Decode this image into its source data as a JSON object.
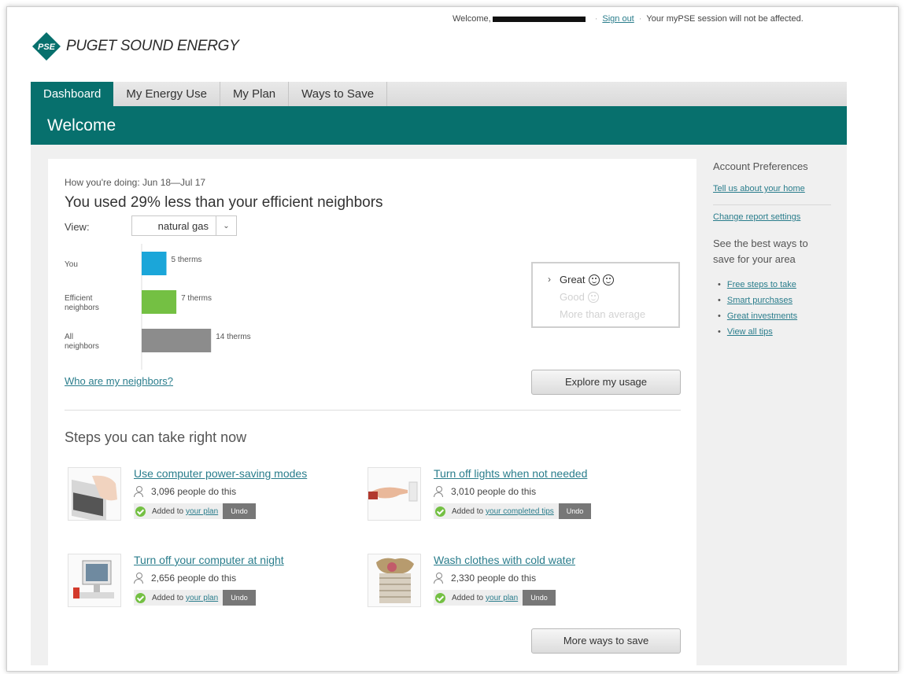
{
  "header": {
    "welcome_prefix": "Welcome,",
    "sign_out": "Sign out",
    "session_note": "Your myPSE session will not be affected."
  },
  "logo": {
    "badge": "PSE",
    "brand": "PUGET SOUND ENERGY",
    "color": "#07706d"
  },
  "tabs": [
    {
      "label": "Dashboard",
      "active": true
    },
    {
      "label": "My Energy Use",
      "active": false
    },
    {
      "label": "My Plan",
      "active": false
    },
    {
      "label": "Ways to Save",
      "active": false
    }
  ],
  "page_title": "Welcome",
  "summary": {
    "period": "How you're doing: Jun 18—Jul 17",
    "headline": "You used 29% less than your efficient neighbors",
    "view_label": "View:",
    "view_value": "natural gas"
  },
  "chart_data": {
    "type": "bar",
    "orientation": "horizontal",
    "categories": [
      "You",
      "Efficient neighbors",
      "All neighbors"
    ],
    "category_lines": [
      [
        "You"
      ],
      [
        "Efficient",
        "neighbors"
      ],
      [
        "All",
        "neighbors"
      ]
    ],
    "values": [
      5,
      7,
      14
    ],
    "value_labels": [
      "5 therms",
      "7 therms",
      "14 therms"
    ],
    "colors": [
      "#1ba6d9",
      "#74c043",
      "#8c8c8c"
    ]
  },
  "rating": {
    "great": "Great",
    "good": "Good",
    "more": "More than average",
    "selected": "Great"
  },
  "links": {
    "neighbors": "Who are my neighbors?"
  },
  "buttons": {
    "explore": "Explore my usage",
    "more_ways": "More ways to save"
  },
  "steps": {
    "title": "Steps you can take right now",
    "undo_label": "Undo",
    "added_prefix": "Added to",
    "items": [
      {
        "title": "Use computer power-saving modes",
        "count": "3,096 people do this",
        "plan_link": "your plan",
        "thumb": "laptop-hand-icon"
      },
      {
        "title": "Turn off lights when not needed",
        "count": "3,010 people do this",
        "plan_link": "your completed tips",
        "thumb": "light-switch-icon"
      },
      {
        "title": "Turn off your computer at night",
        "count": "2,656 people do this",
        "plan_link": "your plan",
        "thumb": "desktop-computer-icon"
      },
      {
        "title": "Wash clothes with cold water",
        "count": "2,330 people do this",
        "plan_link": "your plan",
        "thumb": "laundry-basket-icon"
      }
    ]
  },
  "sidebar": {
    "heading": "Account Preferences",
    "home_link": "Tell us about your home",
    "report_link": "Change report settings",
    "best_ways": "See the best ways to save for your area",
    "tips": [
      "Free steps to take",
      "Smart purchases",
      "Great investments",
      "View all tips"
    ]
  }
}
